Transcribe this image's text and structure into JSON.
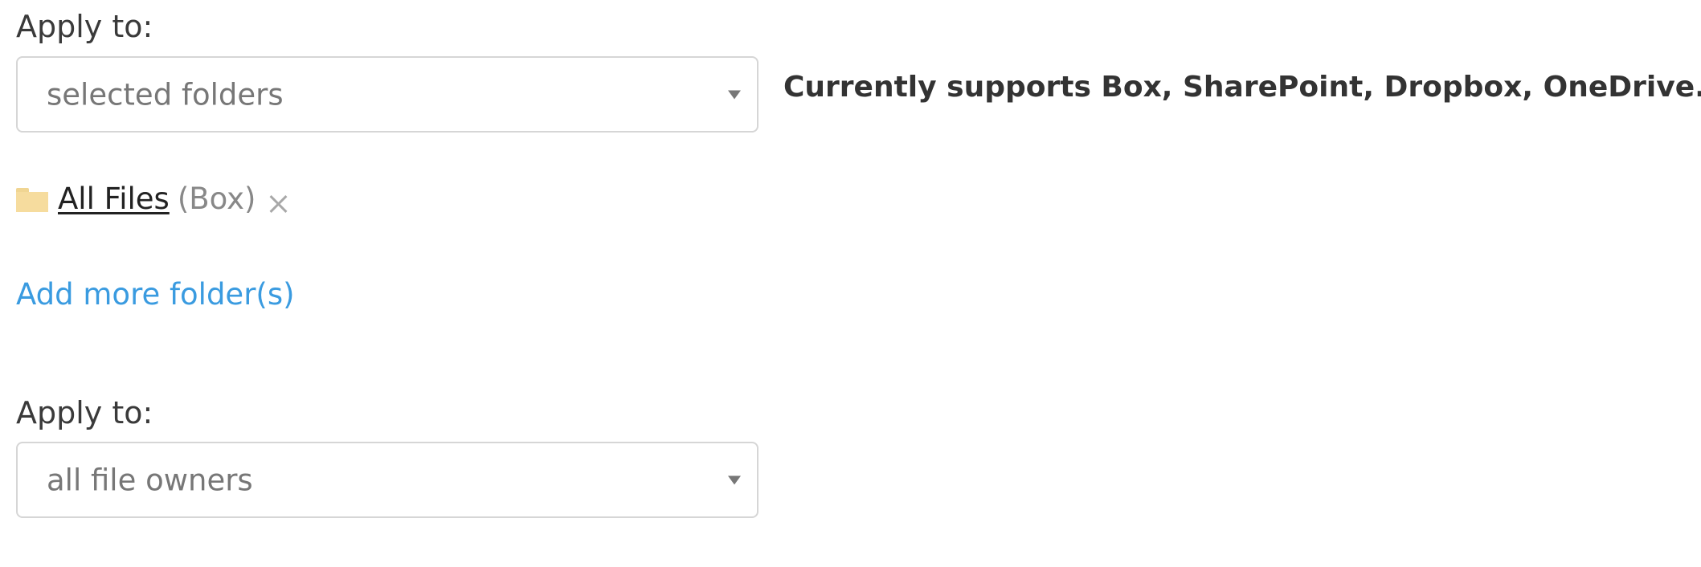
{
  "apply_folders": {
    "label": "Apply to:",
    "selected_value": "selected folders",
    "note": "Currently supports Box, SharePoint, Dropbox, OneDrive."
  },
  "folders": [
    {
      "name": "All Files",
      "source": "(Box)",
      "icon": "folder-icon",
      "remove_icon": "close-icon"
    }
  ],
  "add_more_label": "Add more folder(s)",
  "apply_owners": {
    "label": "Apply to:",
    "selected_value": "all file owners"
  },
  "colors": {
    "link": "#3a9be0",
    "folder": "#f6dc9e",
    "border": "#d6d6d6"
  }
}
